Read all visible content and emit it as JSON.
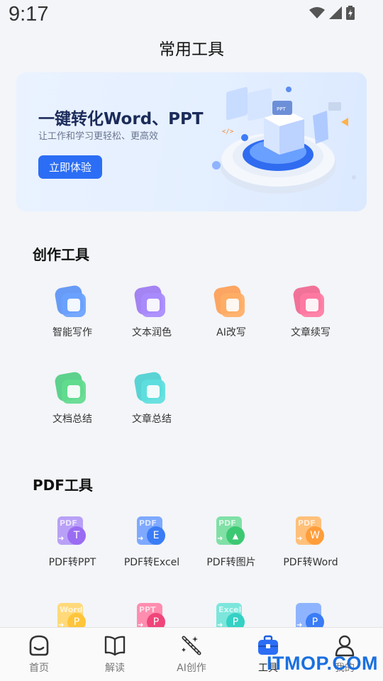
{
  "status": {
    "time": "9:17"
  },
  "page": {
    "title": "常用工具"
  },
  "banner": {
    "title": "一键转化Word、PPT",
    "subtitle": "让工作和学习更轻松、更高效",
    "button": "立即体验"
  },
  "sections": {
    "creation": "创作工具",
    "pdf": "PDF工具"
  },
  "creation_tools": [
    {
      "label": "智能写作",
      "icon": "pen-icon",
      "color": "#3a7cf5"
    },
    {
      "label": "文本润色",
      "icon": "sparkle-brush-icon",
      "color": "#8a5cf0"
    },
    {
      "label": "AI改写",
      "icon": "eraser-icon",
      "color": "#ff8a30"
    },
    {
      "label": "文章续写",
      "icon": "brush-icon",
      "color": "#f0457a"
    },
    {
      "label": "文档总结",
      "icon": "doc-summary-icon",
      "color": "#2cc46a"
    },
    {
      "label": "文章总结",
      "icon": "article-summary-icon",
      "color": "#27c7c9"
    }
  ],
  "pdf_tools": [
    {
      "label": "PDF转PPT",
      "doc": "PDF",
      "letter": "T",
      "color": "#9a6cf2"
    },
    {
      "label": "PDF转Excel",
      "doc": "PDF",
      "letter": "E",
      "color": "#3a7cf5"
    },
    {
      "label": "PDF转图片",
      "doc": "PDF",
      "letter": "▲",
      "color": "#3cc872"
    },
    {
      "label": "PDF转Word",
      "doc": "PDF",
      "letter": "W",
      "color": "#ff9d3a"
    },
    {
      "label": "",
      "doc": "Word",
      "letter": "P",
      "color": "#ffc53a"
    },
    {
      "label": "",
      "doc": "PPT",
      "letter": "P",
      "color": "#f0457a"
    },
    {
      "label": "",
      "doc": "Excel",
      "letter": "P",
      "color": "#34d1c4"
    },
    {
      "label": "",
      "doc": "",
      "letter": "P",
      "color": "#3a7cf5"
    }
  ],
  "nav": [
    {
      "label": "首页",
      "icon": "home-face-icon"
    },
    {
      "label": "解读",
      "icon": "book-icon"
    },
    {
      "label": "AI创作",
      "icon": "magic-wand-icon"
    },
    {
      "label": "工具",
      "icon": "toolbox-icon"
    },
    {
      "label": "我的",
      "icon": "person-icon"
    }
  ],
  "watermark": "ITMOP.COM"
}
